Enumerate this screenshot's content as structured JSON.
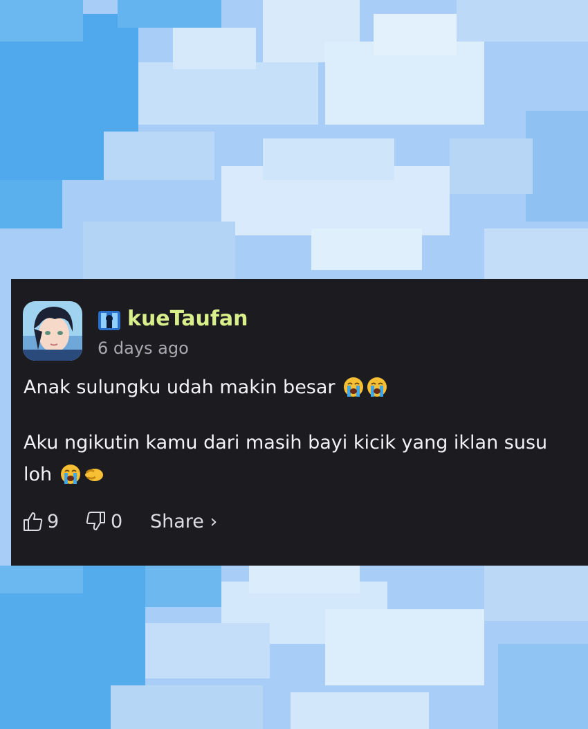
{
  "comment": {
    "username": "kueTaufan",
    "time_ago": "6 days ago",
    "paragraphs": {
      "first": "Anak sulungku udah makin besar",
      "second_line1": "Aku ngikutin kamu dari masih bayi kicik yang iklan susu",
      "second_line2": "loh"
    },
    "emojis": [
      "loudly-crying-face",
      "loudly-crying-face",
      "loudly-crying-face",
      "pinching-hand"
    ],
    "likes": "9",
    "dislikes": "0",
    "share_label": "Share ›"
  },
  "colors": {
    "card_bg": "#1c1b20",
    "username": "#d8ef8c",
    "timestamp": "#a9aab1",
    "sky": "#a9cdf5"
  }
}
